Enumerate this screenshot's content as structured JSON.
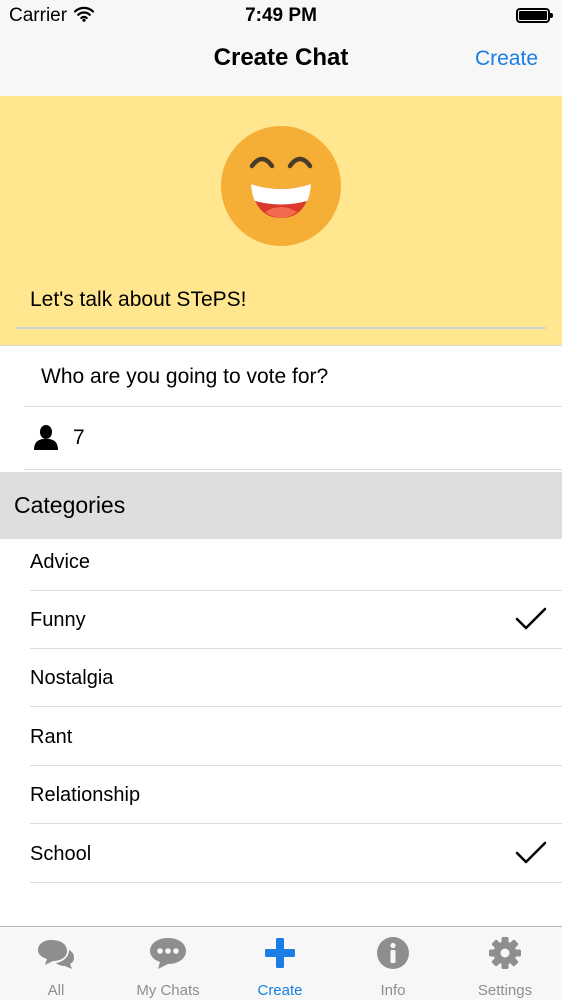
{
  "status": {
    "carrier": "Carrier",
    "time": "7:49 PM"
  },
  "nav": {
    "title": "Create Chat",
    "create_label": "Create"
  },
  "hero": {
    "chat_name": "Let's talk about STePS!",
    "emoji_icon": "laughing-face-icon"
  },
  "details": {
    "question": "Who are you going to vote for?",
    "participant_count": "7"
  },
  "categories": {
    "header": "Categories",
    "items": [
      {
        "label": "Advice",
        "checked": false
      },
      {
        "label": "Funny",
        "checked": true
      },
      {
        "label": "Nostalgia",
        "checked": false
      },
      {
        "label": "Rant",
        "checked": false
      },
      {
        "label": "Relationship",
        "checked": false
      },
      {
        "label": "School",
        "checked": true
      }
    ]
  },
  "tabs": [
    {
      "label": "All",
      "icon": "chat-bubbles-icon"
    },
    {
      "label": "My Chats",
      "icon": "chat-dots-icon"
    },
    {
      "label": "Create",
      "icon": "plus-icon",
      "active": true
    },
    {
      "label": "Info",
      "icon": "info-icon"
    },
    {
      "label": "Settings",
      "icon": "gear-icon"
    }
  ],
  "colors": {
    "accent": "#1a7ee5",
    "hero_bg": "#ffe68f",
    "header_bg": "#dedede",
    "emoji_face": "#f5ae36"
  }
}
